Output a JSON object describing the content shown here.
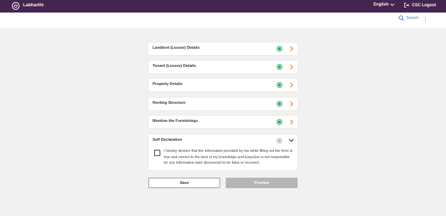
{
  "header": {
    "app_title": "Labharthi",
    "language": "English",
    "logout_label": "CSC Logout"
  },
  "toolbar": {
    "search_label": "Search"
  },
  "sections": [
    {
      "label": "Landlord (Lessor) Details",
      "status": "complete"
    },
    {
      "label": "Tenant (Lessee) Details",
      "status": "complete"
    },
    {
      "label": "Property Details",
      "status": "complete"
    },
    {
      "label": "Renting Structure",
      "status": "complete"
    },
    {
      "label": "Mention the Furnishings",
      "status": "complete"
    }
  ],
  "declaration": {
    "title": "Self Declaration",
    "status": "pending",
    "checked": false,
    "text": "I hereby declare that the information provided by me while filling out the form is true and correct to the best of my knowledge and EasyGov is not responsible for any information later discovered to be false or incorrect."
  },
  "actions": {
    "save_label": "Save",
    "preview_label": "Preview"
  },
  "colors": {
    "header_bg": "#44254f",
    "complete": "#23a55a",
    "pending": "#b9b9b9",
    "chevron": "#f07a2a",
    "link": "#3a6fcf"
  }
}
